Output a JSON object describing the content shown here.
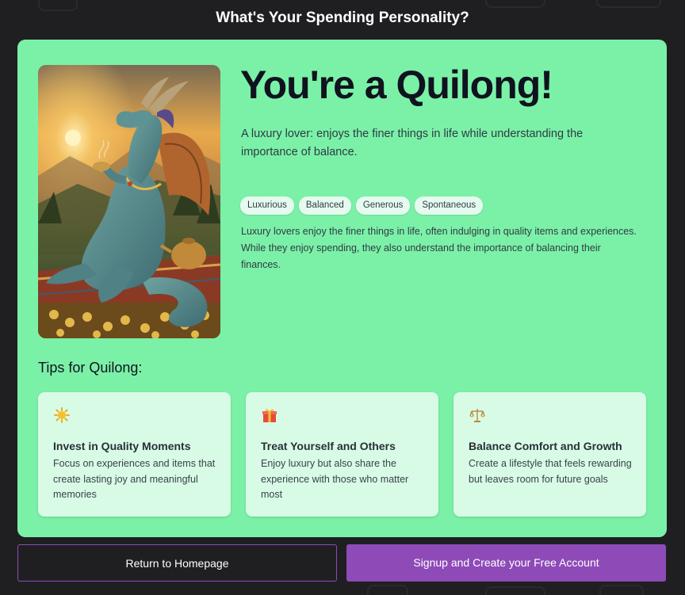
{
  "header": {
    "title": "What's Your Spending Personality?"
  },
  "result": {
    "title": "You're a Quilong!",
    "tagline": "A luxury lover: enjoys the finer things in life while understanding the importance of balance.",
    "tags": [
      "Luxurious",
      "Balanced",
      "Generous",
      "Spontaneous"
    ],
    "description": "Luxury lovers enjoy the finer things in life, often indulging in quality items and experiences. While they enjoy spending, they also understand the importance of balancing their finances."
  },
  "tips": {
    "heading": "Tips for Quilong:",
    "items": [
      {
        "icon": "sun-icon",
        "title": "Invest in Quality Moments",
        "text": "Focus on experiences and items that create lasting joy and meaningful memories"
      },
      {
        "icon": "gift-icon",
        "title": "Treat Yourself and Others",
        "text": "Enjoy luxury but also share the experience with those who matter most"
      },
      {
        "icon": "scales-icon",
        "title": "Balance Comfort and Growth",
        "text": "Create a lifestyle that feels rewarding but leaves room for future goals"
      }
    ]
  },
  "actions": {
    "return_label": "Return to Homepage",
    "signup_label": "Signup and Create your Free Account"
  },
  "colors": {
    "background": "#1f1f22",
    "card": "#7bf1a8",
    "tip_card": "#d8fbe6",
    "accent": "#8e4bb8"
  }
}
